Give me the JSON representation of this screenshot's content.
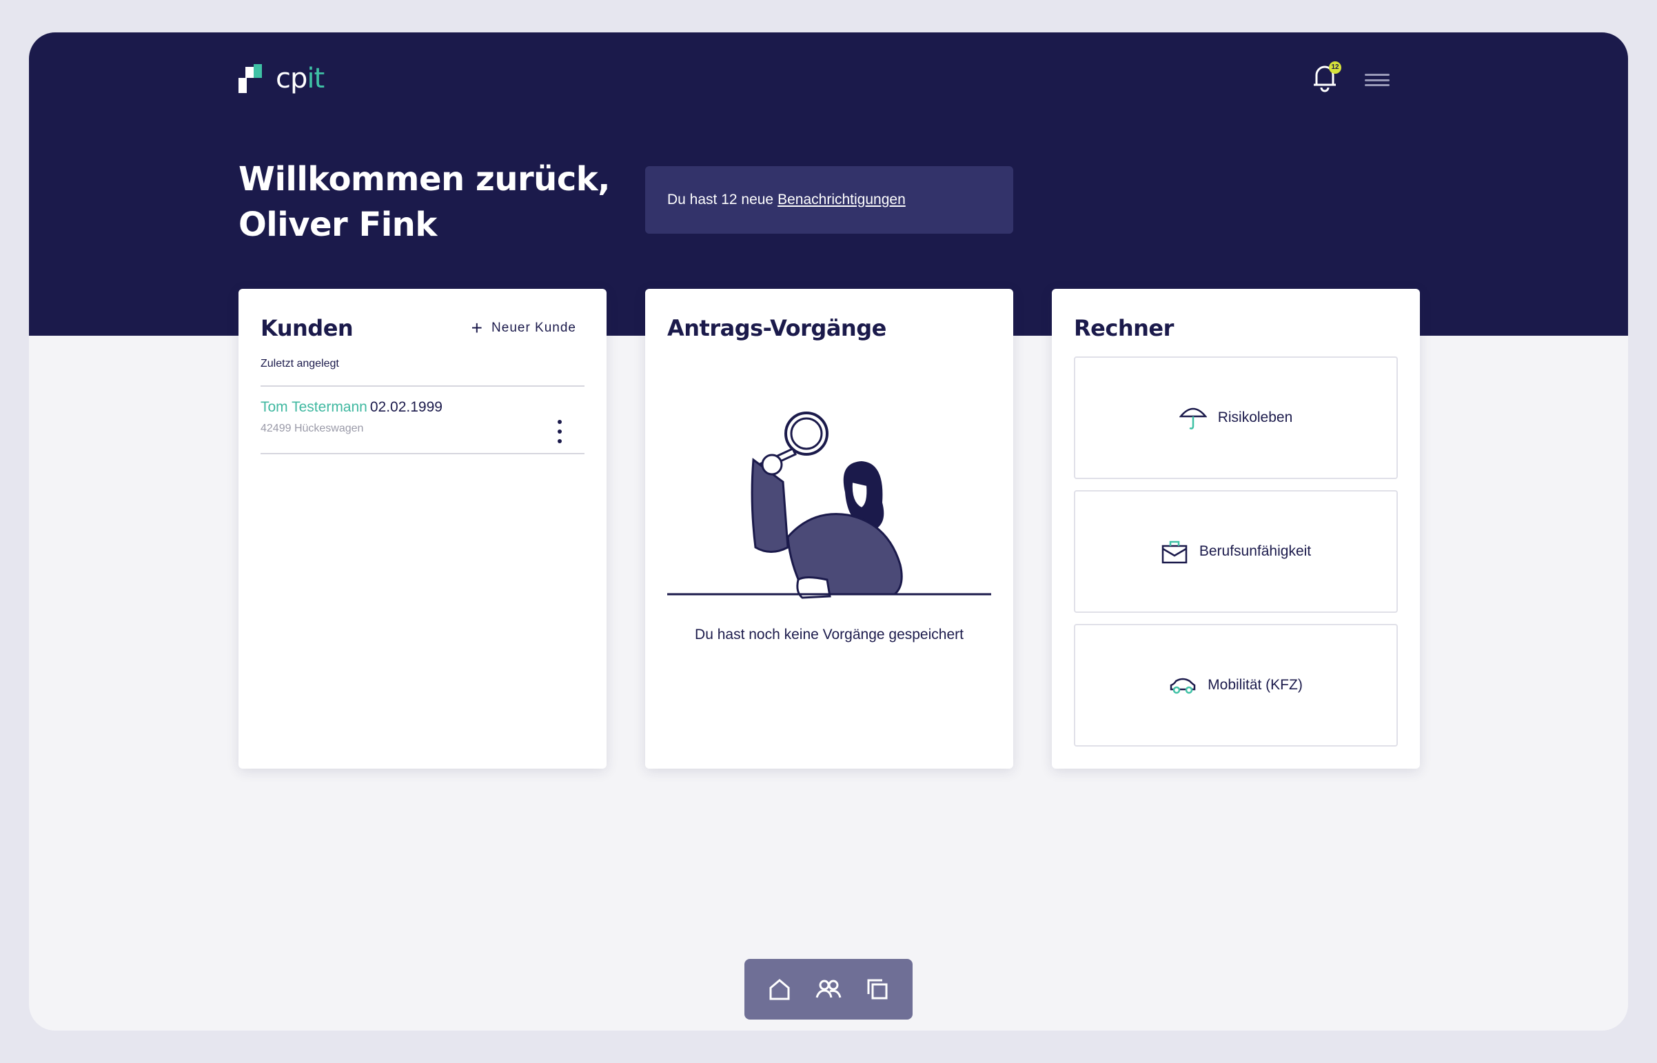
{
  "header": {
    "logo_text_a": "cp",
    "logo_text_b": "it",
    "notification_count": "12",
    "bell_icon": "bell-icon",
    "menu_icon": "hamburger-menu-icon"
  },
  "welcome": {
    "line1": "Willkommen zurück,",
    "line2": "Oliver Fink"
  },
  "notice": {
    "text": "Du hast 12 neue",
    "link": "Benachrichtigungen"
  },
  "customers": {
    "title": "Kunden",
    "new_customer": "Neuer Kunde",
    "recent_label": "Zuletzt angelegt",
    "items": [
      {
        "name": "Tom Testermann",
        "birthdate": "02.02.1999",
        "location": "42499 Hückeswagen"
      }
    ]
  },
  "applications": {
    "title": "Antrags-Vorgänge",
    "empty_text": "Du hast noch keine Vorgänge gespeichert"
  },
  "calculators": {
    "title": "Rechner",
    "items": [
      {
        "label": "Risikoleben",
        "icon": "umbrella-icon"
      },
      {
        "label": "Berufsunfähigkeit",
        "icon": "briefcase-icon"
      },
      {
        "label": "Mobilität (KFZ)",
        "icon": "car-icon"
      }
    ]
  },
  "bottom_nav": {
    "items": [
      "home-icon",
      "users-icon",
      "copy-icon"
    ]
  },
  "colors": {
    "navy": "#1b1a4b",
    "teal": "#3fc1a5",
    "badge": "#d6e23a"
  }
}
